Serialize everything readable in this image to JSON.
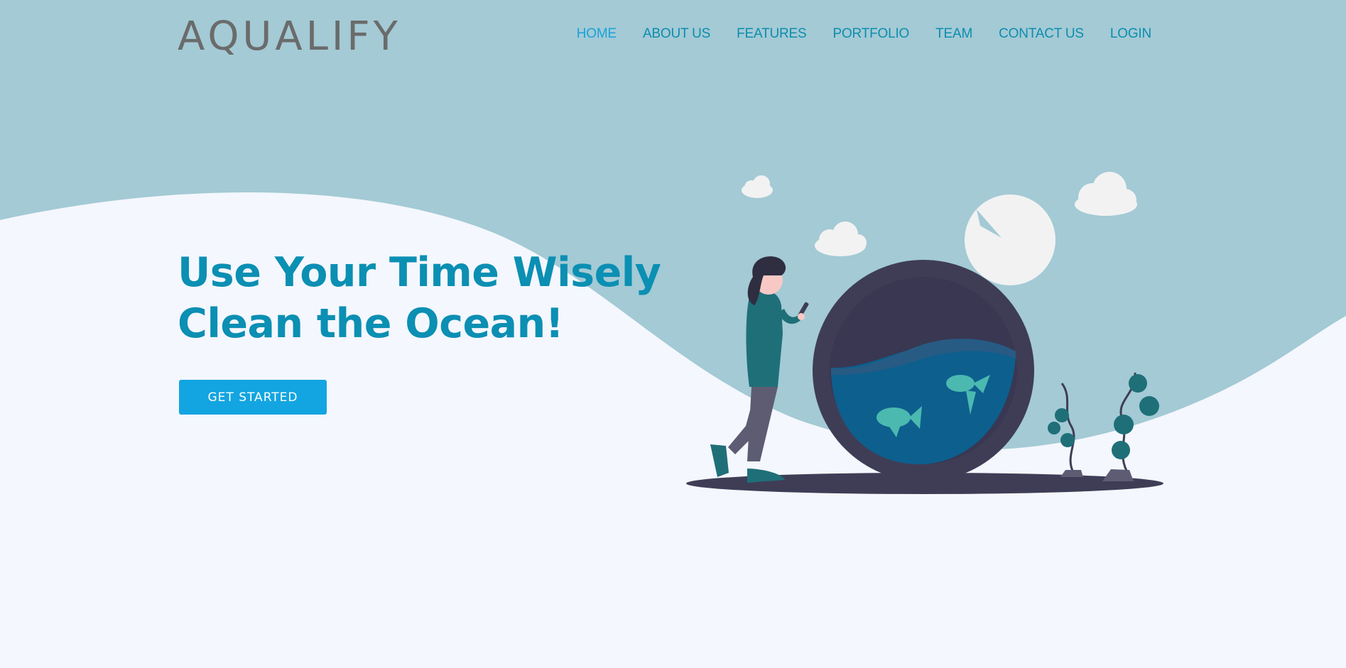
{
  "brand": {
    "name": "AQUALIFY"
  },
  "nav": {
    "items": [
      {
        "label": "HOME",
        "active": true
      },
      {
        "label": "ABOUT US"
      },
      {
        "label": "FEATURES"
      },
      {
        "label": "PORTFOLIO"
      },
      {
        "label": "TEAM"
      },
      {
        "label": "CONTACT US"
      },
      {
        "label": "LOGIN"
      }
    ]
  },
  "hero": {
    "title_line1": "Use Your Time Wisely",
    "title_line2": "Clean the Ocean!",
    "cta_label": "GET STARTED"
  },
  "colors": {
    "sky": "#a3cad5",
    "page_background": "#f4f7fd",
    "accent": "#0b8fb3",
    "nav_active": "#1aa3d9",
    "button": "#13a5e1",
    "logo_text": "#6b6b6b"
  },
  "icons": [
    "cloud-icon",
    "moon-icon",
    "woman-illustration",
    "fish-bowl-icon",
    "fish-icon",
    "seaweed-plant-icon"
  ]
}
